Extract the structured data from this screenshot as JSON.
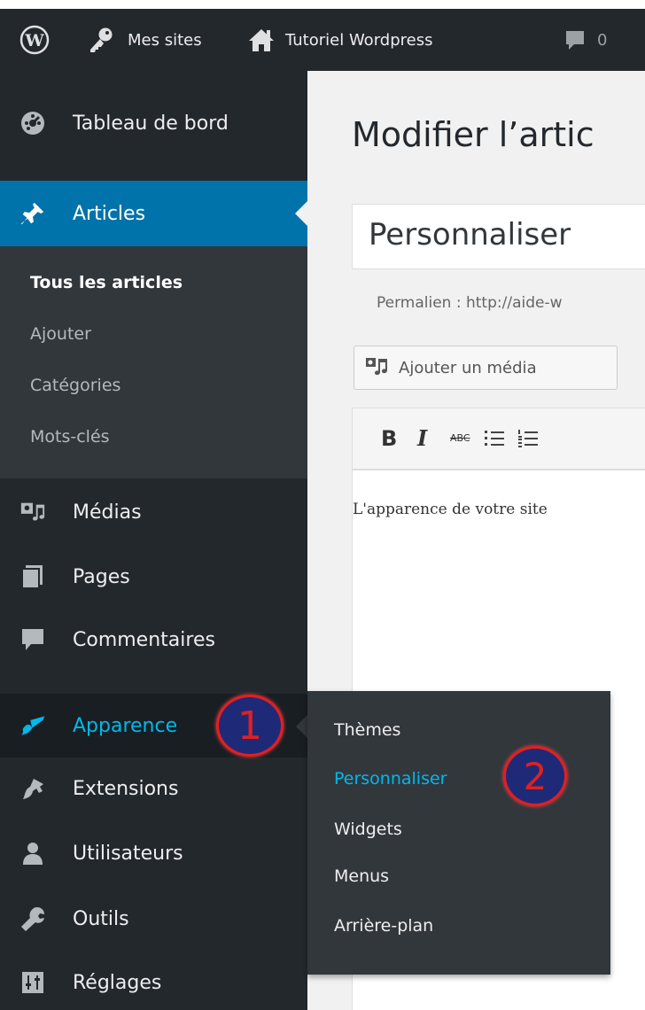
{
  "admin_bar": {
    "my_sites": "Mes sites",
    "site_name": "Tutoriel Wordpress",
    "comment_count": "0"
  },
  "sidebar": {
    "dashboard": "Tableau de bord",
    "articles": "Articles",
    "articles_sub": [
      "Tous les articles",
      "Ajouter",
      "Catégories",
      "Mots-clés"
    ],
    "medias": "Médias",
    "pages": "Pages",
    "comments": "Commentaires",
    "appearance": "Apparence",
    "extensions": "Extensions",
    "users": "Utilisateurs",
    "tools": "Outils",
    "settings": "Réglages"
  },
  "flyout": {
    "items": [
      "Thèmes",
      "Personnaliser",
      "Widgets",
      "Menus",
      "Arrière-plan"
    ]
  },
  "editor": {
    "page_title": "Modifier l’artic",
    "post_title": "Personnaliser",
    "permalink": "Permalien : http://aide-w",
    "add_media": "Ajouter un média",
    "toolbar": {
      "bold": "B",
      "italic": "I",
      "strike": "ABC"
    },
    "body_text": "L'apparence de votre site"
  },
  "callouts": {
    "one": "1",
    "two": "2"
  },
  "colors": {
    "adminbar_bg": "#23282d",
    "sidebar_bg": "#23282d",
    "submenu_bg": "#32373c",
    "active_bg": "#0073aa",
    "link_blue": "#00b9eb",
    "callout_fill": "#1e2a78",
    "callout_ring": "#e02020"
  },
  "icons": [
    "wordpress-logo-icon",
    "key-icon",
    "home-icon",
    "comment-icon",
    "dashboard-icon",
    "pin-icon",
    "media-icon",
    "pages-icon",
    "comments-icon",
    "brush-icon",
    "plugin-icon",
    "user-icon",
    "wrench-icon",
    "settings-icon",
    "add-media-icon",
    "bold-icon",
    "italic-icon",
    "strikethrough-icon",
    "bullet-list-icon",
    "numbered-list-icon"
  ]
}
